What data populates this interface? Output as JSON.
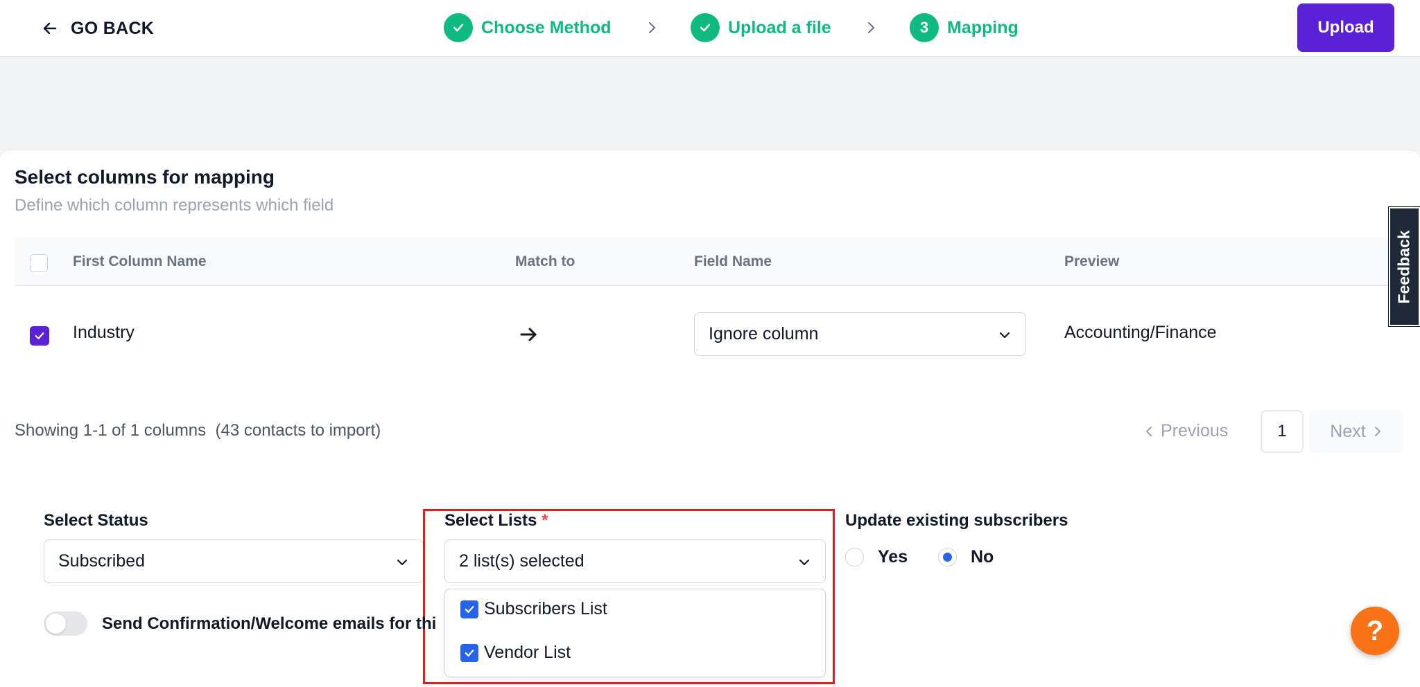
{
  "header": {
    "go_back_label": "GO BACK",
    "steps": [
      {
        "label": "Choose Method",
        "state": "done"
      },
      {
        "label": "Upload a file",
        "state": "done"
      },
      {
        "label": "Mapping",
        "number": "3",
        "state": "current"
      }
    ],
    "upload_label": "Upload"
  },
  "mapping": {
    "title": "Select columns for mapping",
    "subtitle": "Define which column represents which field",
    "columns": {
      "first_column_name": "First Column Name",
      "match_to": "Match to",
      "field_name": "Field Name",
      "preview": "Preview"
    },
    "rows": [
      {
        "checked": true,
        "column": "Industry",
        "field": "Ignore column",
        "preview": "Accounting/Finance"
      }
    ]
  },
  "pagination": {
    "showing": "Showing 1-1 of 1 columns",
    "contacts": "(43 contacts to import)",
    "previous": "Previous",
    "page": "1",
    "next": "Next"
  },
  "form": {
    "status_label": "Select Status",
    "status_value": "Subscribed",
    "lists_label": "Select Lists",
    "lists_required": "*",
    "lists_value": "2 list(s) selected",
    "lists_options": [
      {
        "label": "Subscribers List",
        "checked": true
      },
      {
        "label": "Vendor List",
        "checked": true
      }
    ],
    "update_label": "Update existing subscribers",
    "update_yes": "Yes",
    "update_no": "No",
    "update_selected": "No",
    "confirmation_label": "Send Confirmation/Welcome emails for thi",
    "confirmation_enabled": false
  },
  "feedback_label": "Feedback",
  "help_label": "?",
  "colors": {
    "accent": "#5b21d6",
    "success": "#10b981",
    "checkbox_blue": "#2563eb",
    "help_orange": "#f97316",
    "highlight_red": "#e11d1d"
  }
}
